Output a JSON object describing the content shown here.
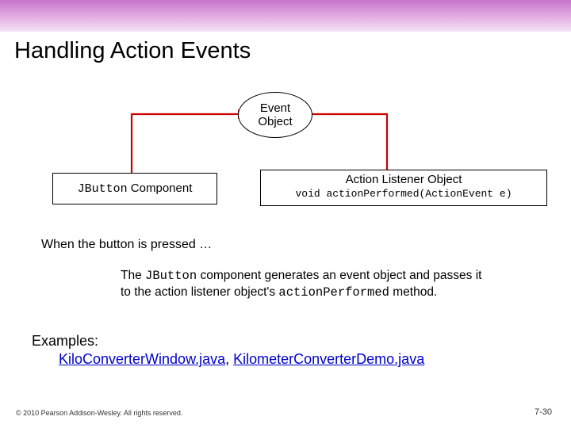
{
  "slide": {
    "title": "Handling Action Events",
    "event_node_l1": "Event",
    "event_node_l2": "Object",
    "jbutton_code": "JButton",
    "jbutton_plain": " Component",
    "listener_title": "Action Listener Object",
    "listener_sig": "void actionPerformed(ActionEvent e)",
    "when_text": "When the button is pressed …",
    "body_pre": "The ",
    "body_code1": "JButton",
    "body_mid": " component generates an event object and passes it to the action listener object's ",
    "body_code2": "actionPerformed",
    "body_post": " method.",
    "examples_label": "Examples:",
    "example_link1": "KiloConverterWindow.java",
    "examples_sep": ", ",
    "example_link2": "KilometerConverterDemo.java",
    "copyright": "© 2010 Pearson Addison-Wesley. All rights reserved.",
    "page_number": "7-30"
  }
}
